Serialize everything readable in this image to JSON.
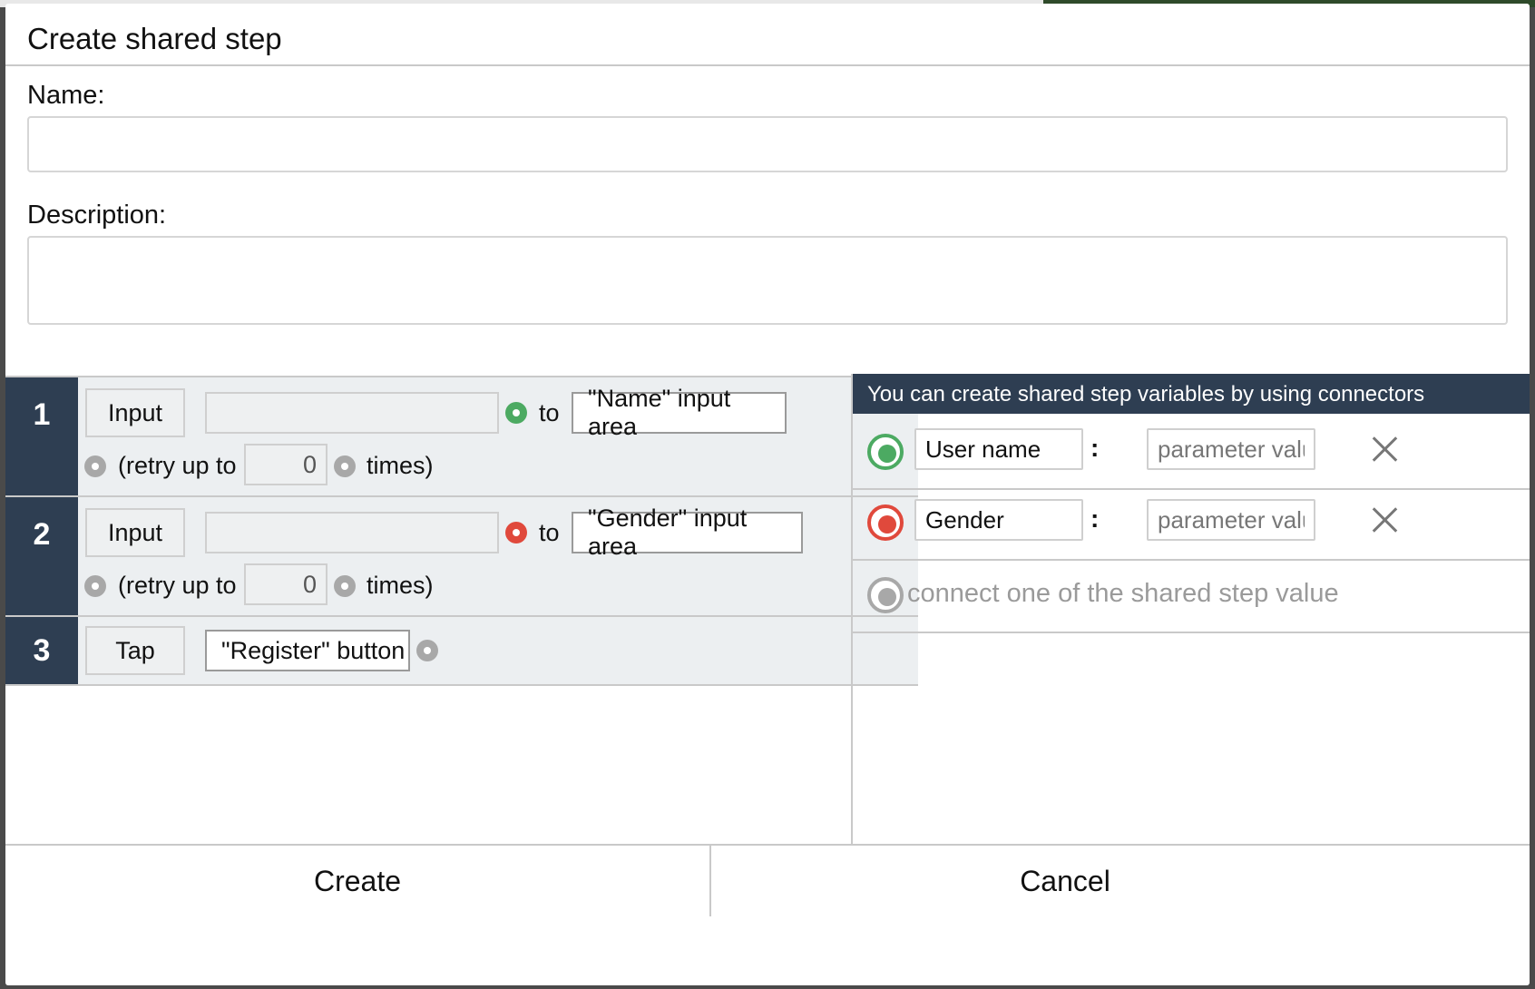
{
  "dialog": {
    "title": "Create shared step",
    "name_label": "Name:",
    "name_value": "",
    "description_label": "Description:",
    "description_value": ""
  },
  "steps": [
    {
      "number": "1",
      "action": "Input",
      "value": "",
      "to_label": "to",
      "target": "\"Name\" input area",
      "connector_color": "#4caa62",
      "retry_prefix": "(retry up to",
      "retry_count": "0",
      "retry_suffix": "times)"
    },
    {
      "number": "2",
      "action": "Input",
      "value": "",
      "to_label": "to",
      "target": "\"Gender\" input area",
      "connector_color": "#e0493c",
      "retry_prefix": "(retry up to",
      "retry_count": "0",
      "retry_suffix": "times)"
    },
    {
      "number": "3",
      "action": "Tap",
      "target": "\"Register\" button"
    }
  ],
  "variables_panel": {
    "header": "You can create shared step variables by using connectors",
    "variables": [
      {
        "name": "User name",
        "placeholder": "parameter value",
        "color": "#4caa62"
      },
      {
        "name": "Gender",
        "placeholder": "parameter value",
        "color": "#e0493c"
      }
    ],
    "connect_hint": "connect one of the shared step value"
  },
  "footer": {
    "create_label": "Create",
    "cancel_label": "Cancel"
  }
}
